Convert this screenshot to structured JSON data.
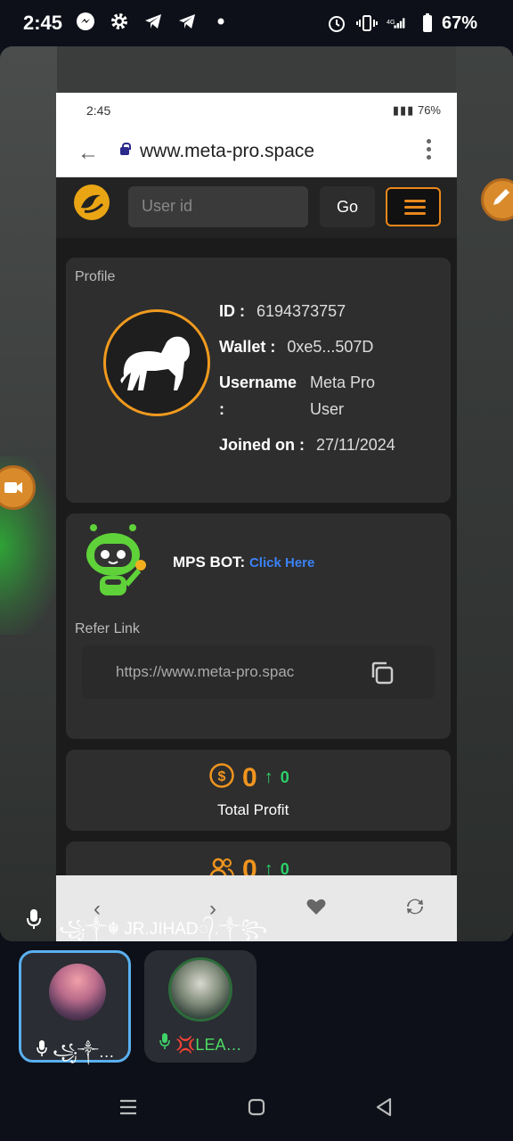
{
  "status_bar": {
    "time": "2:45",
    "battery": "67%"
  },
  "phone": {
    "status_time": "2:45",
    "status_battery": "76%",
    "url": "www.meta-pro.space"
  },
  "site": {
    "userid_placeholder": "User id",
    "go_label": "Go",
    "profile": {
      "section_label": "Profile",
      "id_label": "ID :",
      "id_value": "6194373757",
      "wallet_label": "Wallet :",
      "wallet_value": "0xe5...507D",
      "username_label": "Username",
      "username_colon": ":",
      "username_value_1": "Meta Pro",
      "username_value_2": "User",
      "joined_label": "Joined on :",
      "joined_value": "27/11/2024"
    },
    "bot": {
      "label": "MPS BOT:",
      "link": "Click Here"
    },
    "refer": {
      "label": "Refer Link",
      "value": "https://www.meta-pro.spac"
    },
    "total_profit": {
      "value": "0",
      "change": "0",
      "label": "Total Profit"
    },
    "team": {
      "value": "0",
      "change": "0"
    }
  },
  "call": {
    "overlay_name": "꧁༒☬ JR.JIHAD᭄.༒꧂",
    "participants": [
      {
        "name": "꧁༒…"
      },
      {
        "name": "💢LEA…"
      }
    ]
  },
  "colors": {
    "accent": "#f0951e",
    "link": "#3b82f6",
    "positive": "#2bd16a",
    "active_tile_border": "#5ab0f0"
  }
}
